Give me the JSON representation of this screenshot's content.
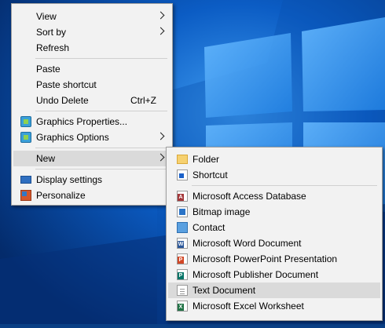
{
  "context_menu": {
    "view": "View",
    "sort_by": "Sort by",
    "refresh": "Refresh",
    "paste": "Paste",
    "paste_shortcut": "Paste shortcut",
    "undo_delete": "Undo Delete",
    "undo_delete_shortcut": "Ctrl+Z",
    "graphics_properties": "Graphics Properties...",
    "graphics_options": "Graphics Options",
    "new": "New",
    "display_settings": "Display settings",
    "personalize": "Personalize"
  },
  "new_submenu": {
    "folder": "Folder",
    "shortcut": "Shortcut",
    "access": "Microsoft Access Database",
    "bitmap": "Bitmap image",
    "contact": "Contact",
    "word": "Microsoft Word Document",
    "powerpoint": "Microsoft PowerPoint Presentation",
    "publisher": "Microsoft Publisher Document",
    "text": "Text Document",
    "excel": "Microsoft Excel Worksheet"
  },
  "icons": {
    "access": "A",
    "word": "W",
    "powerpoint": "P",
    "publisher": "P",
    "excel": "X"
  },
  "colors": {
    "menu_bg": "#f2f2f2",
    "highlight": "#dadada",
    "desktop": "#0a3f85",
    "access": "#a4373a",
    "word": "#2b579a",
    "powerpoint": "#d24726",
    "publisher": "#077568",
    "excel": "#217346"
  }
}
